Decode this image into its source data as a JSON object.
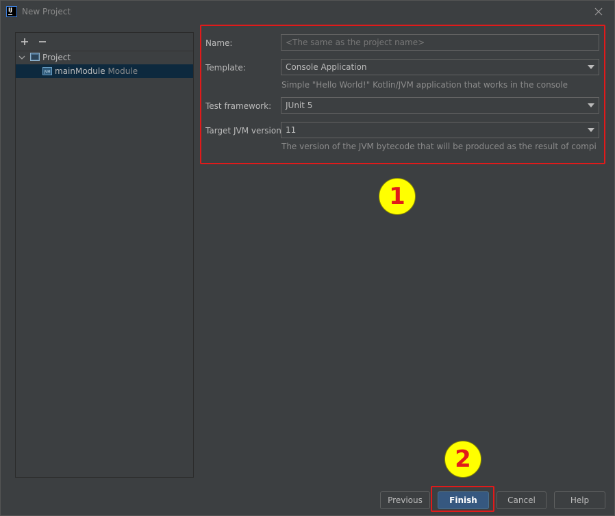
{
  "window": {
    "title": "New Project"
  },
  "tree": {
    "toolbar": {
      "add_symbol": "+",
      "remove_symbol": "−"
    },
    "items": [
      {
        "label": "Project",
        "suffix": ""
      },
      {
        "label": "mainModule",
        "suffix": "Module"
      }
    ]
  },
  "form": {
    "name": {
      "label": "Name:",
      "placeholder": "<The same as the project name>"
    },
    "template": {
      "label": "Template:",
      "value": "Console Application",
      "hint": "Simple \"Hello World!\" Kotlin/JVM application that works in the console"
    },
    "test_framework": {
      "label": "Test framework:",
      "value": "JUnit 5"
    },
    "target_jvm": {
      "label": "Target JVM version:",
      "value": "11",
      "hint": "The version of the JVM bytecode that will be produced as the result of compiling this ..."
    }
  },
  "markers": {
    "one": "1",
    "two": "2"
  },
  "buttons": {
    "previous": "Previous",
    "finish": "Finish",
    "cancel": "Cancel",
    "help": "Help"
  },
  "colors": {
    "background": "#3c3f41",
    "accent_button": "#365880",
    "highlight_red": "#e11a1a",
    "marker_yellow": "#ffff00",
    "selection": "#0d293e"
  }
}
